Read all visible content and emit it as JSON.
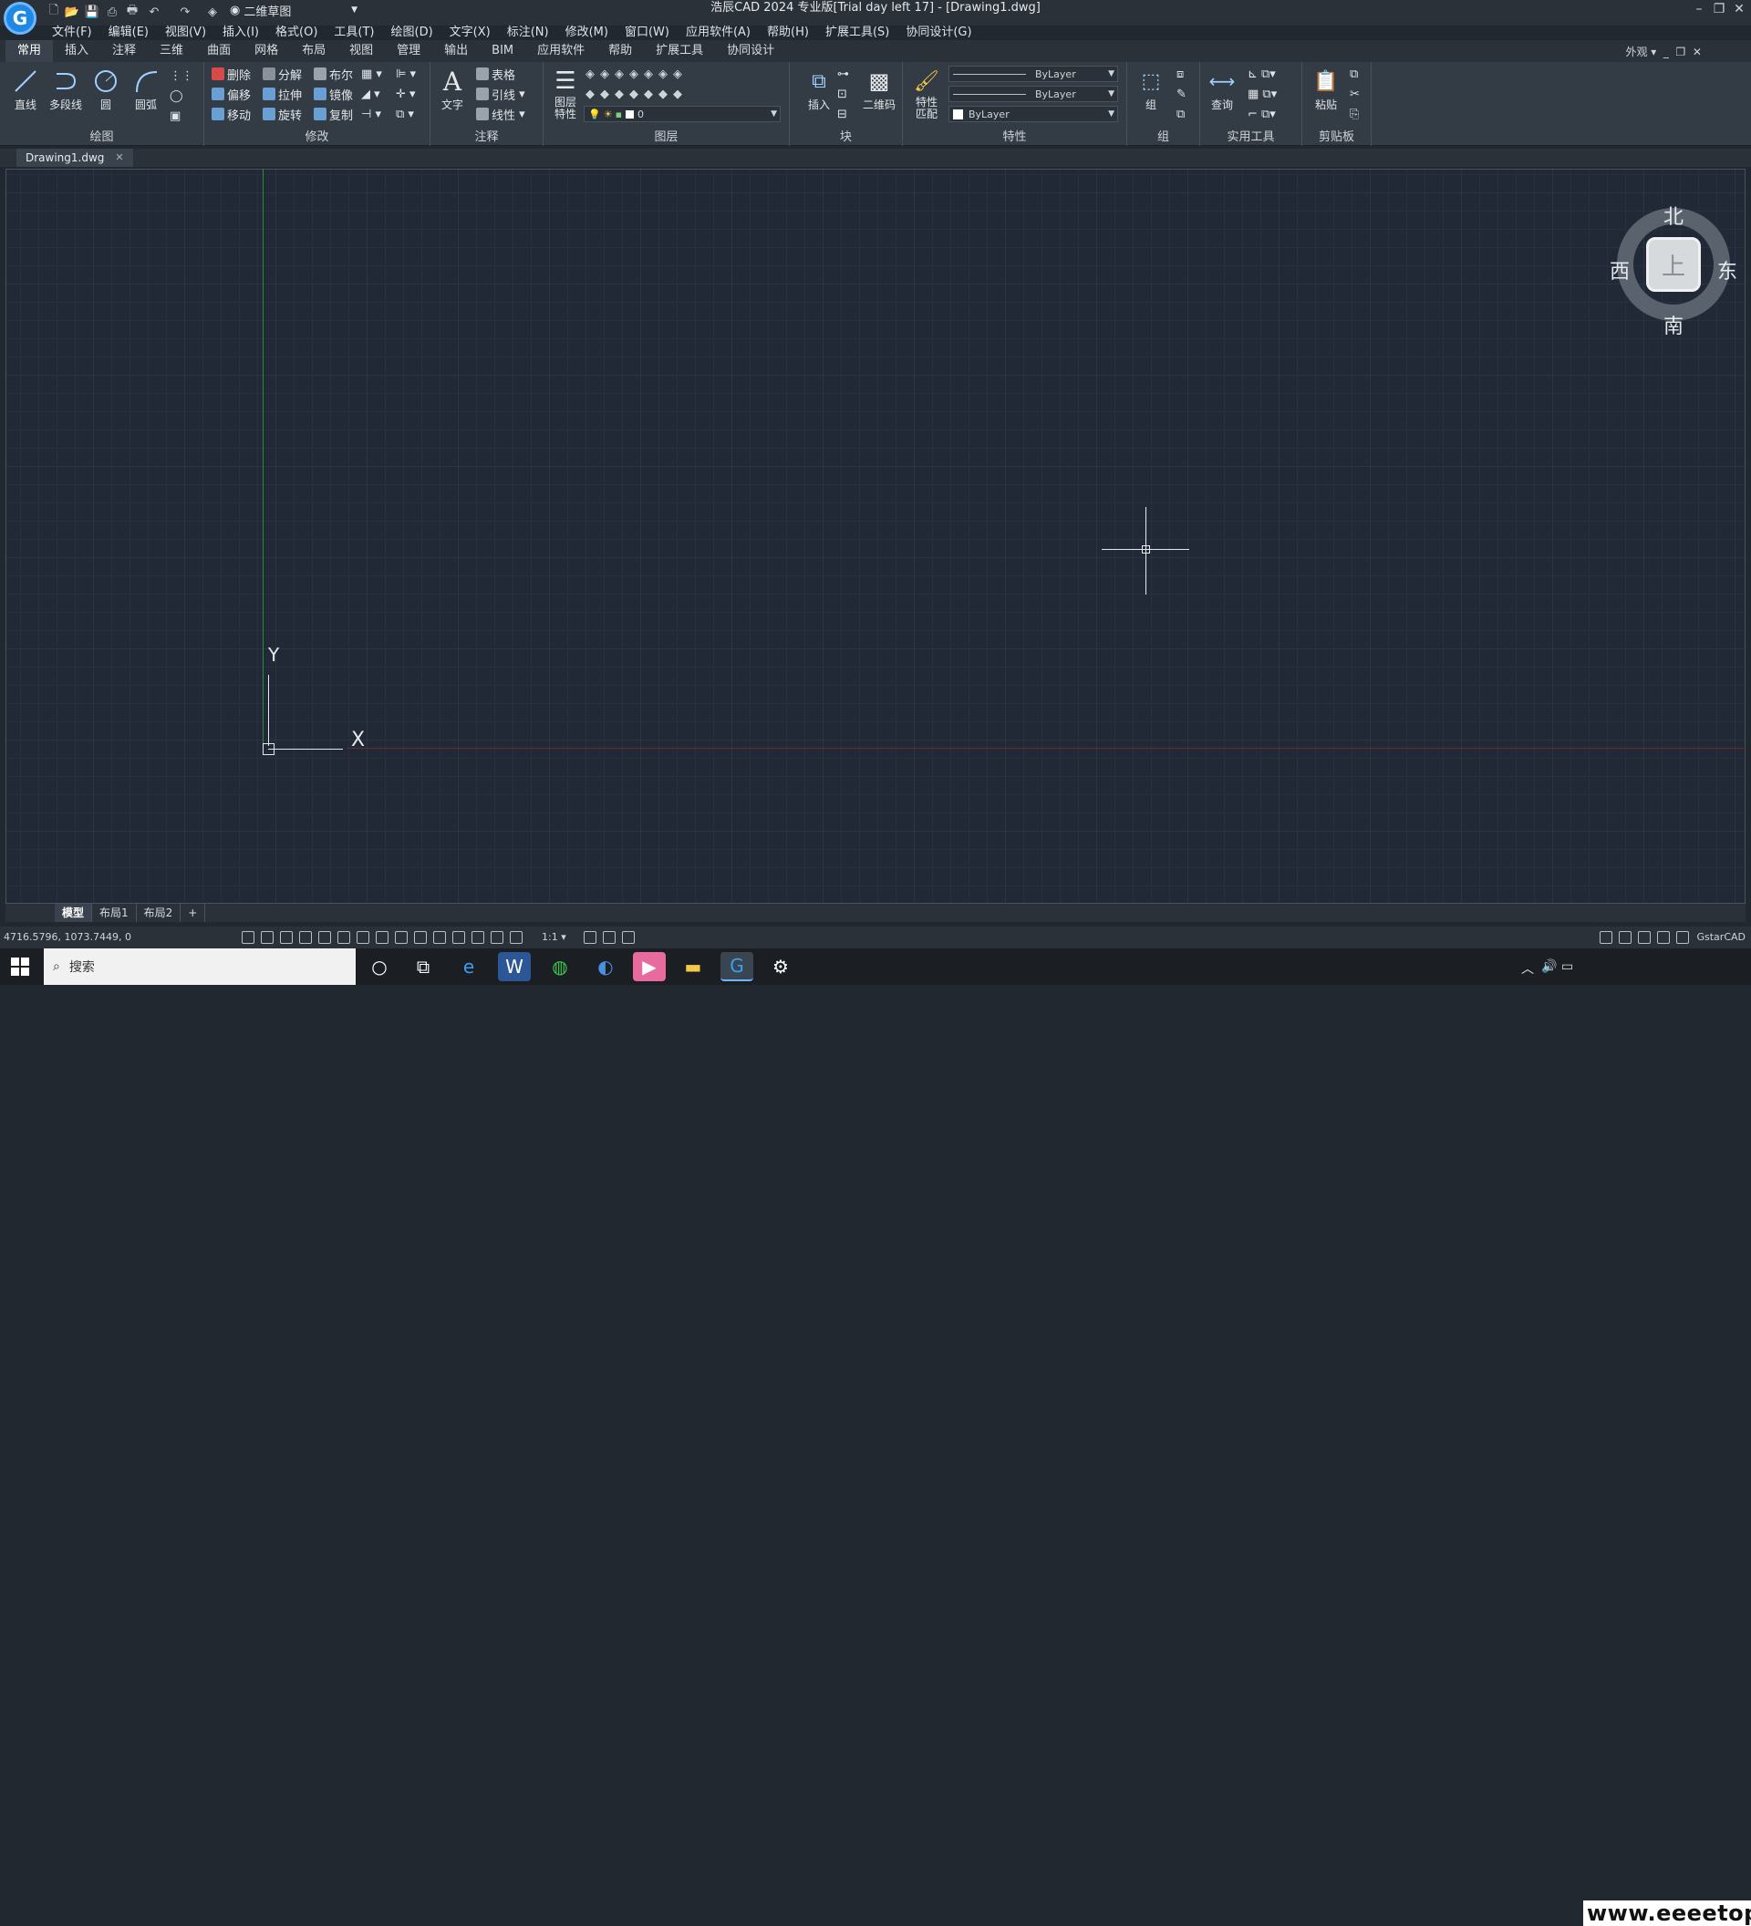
{
  "window": {
    "title": "浩辰CAD 2024 专业版[Trial day left 17] - [Drawing1.dwg]",
    "workspace": "二维草图",
    "controls": [
      "–",
      "❐",
      "✕"
    ]
  },
  "menu": [
    "文件(F)",
    "编辑(E)",
    "视图(V)",
    "插入(I)",
    "格式(O)",
    "工具(T)",
    "绘图(D)",
    "文字(X)",
    "标注(N)",
    "修改(M)",
    "窗口(W)",
    "应用软件(A)",
    "帮助(H)",
    "扩展工具(S)",
    "协同设计(G)"
  ],
  "ribbon_tabs": [
    "常用",
    "插入",
    "注释",
    "三维",
    "曲面",
    "网格",
    "布局",
    "视图",
    "管理",
    "输出",
    "BIM",
    "应用软件",
    "帮助",
    "扩展工具",
    "协同设计"
  ],
  "appearance": "外观",
  "panels": {
    "draw": {
      "title": "绘图",
      "line": "直线",
      "polyline": "多段线",
      "circle": "圆",
      "arc": "圆弧"
    },
    "modify": {
      "title": "修改",
      "items": [
        "删除",
        "分解",
        "布尔",
        "偏移",
        "拉伸",
        "镜像",
        "移动",
        "旋转",
        "复制"
      ]
    },
    "annotate": {
      "title": "注释",
      "text": "文字",
      "table": "表格",
      "leader": "引线",
      "linear": "线性"
    },
    "layer": {
      "title": "图层",
      "props": "图层\n特性",
      "current": "0"
    },
    "block": {
      "title": "块",
      "insert": "插入",
      "qr": "二维码"
    },
    "properties": {
      "title": "特性",
      "match": "特性\n匹配",
      "linetype1": "ByLayer",
      "linetype2": "ByLayer",
      "color": "ByLayer"
    },
    "group": {
      "title": "组",
      "group": "组"
    },
    "utilities": {
      "title": "实用工具",
      "query": "查询"
    },
    "clipboard": {
      "title": "剪贴板",
      "paste": "粘贴"
    }
  },
  "document_tab": "Drawing1.dwg",
  "ucs": {
    "x": "X",
    "y": "Y"
  },
  "viewcube": {
    "north": "北",
    "south": "南",
    "east": "东",
    "west": "西",
    "face": "上"
  },
  "layout_tabs": [
    "模型",
    "布局1",
    "布局2",
    "+"
  ],
  "status": {
    "coords": "4716.5796, 1073.7449, 0",
    "scale": "1:1",
    "brand": "GstarCAD"
  },
  "taskbar": {
    "search": "搜索",
    "watermark": "www.eeeetop.com"
  }
}
